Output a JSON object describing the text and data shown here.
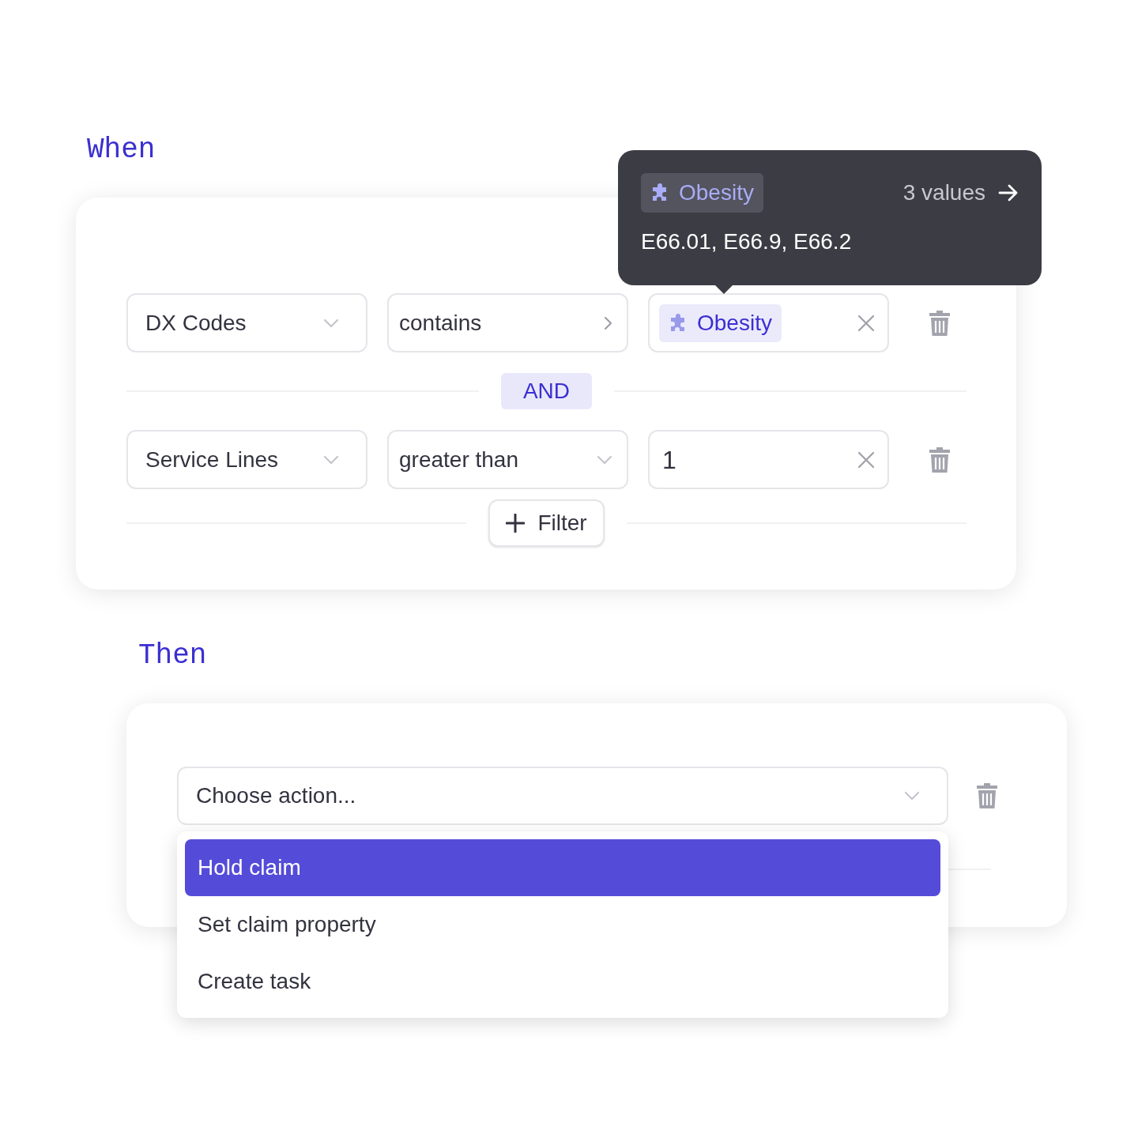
{
  "when": {
    "label": "When",
    "conditions": [
      {
        "field": "DX Codes",
        "operator": {
          "text": "contains",
          "kind": "submenu"
        },
        "value": {
          "kind": "tag",
          "text": "Obesity"
        }
      },
      {
        "field": "Service Lines",
        "operator": {
          "text": "greater than",
          "kind": "dropdown"
        },
        "value": {
          "kind": "text",
          "text": "1"
        }
      }
    ],
    "joiner": "AND",
    "add_button": "Filter",
    "tooltip": {
      "tag": "Obesity",
      "count": "3 values",
      "values": "E66.01, E66.9, E66.2"
    }
  },
  "then": {
    "label": "Then",
    "action_select": {
      "placeholder": "Choose action..."
    },
    "menu": [
      {
        "label": "Hold claim",
        "selected": true
      },
      {
        "label": "Set claim property",
        "selected": false
      },
      {
        "label": "Create task",
        "selected": false
      }
    ]
  }
}
